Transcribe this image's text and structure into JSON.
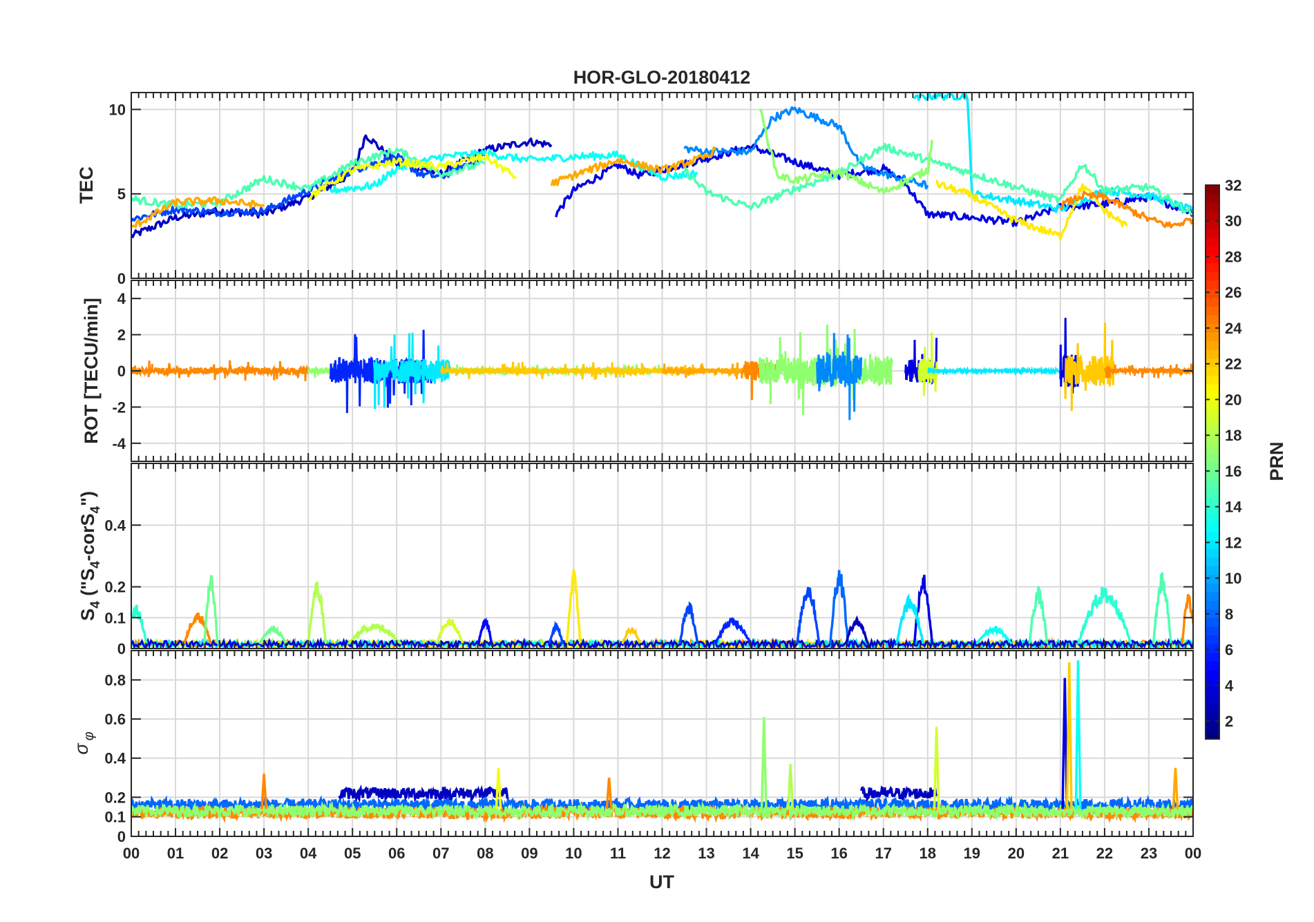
{
  "chart_data": {
    "type": "line",
    "title": "HOR-GLO-20180412",
    "xlabel": "UT",
    "x_tick_labels": [
      "00",
      "01",
      "02",
      "03",
      "04",
      "05",
      "06",
      "07",
      "08",
      "09",
      "10",
      "11",
      "12",
      "13",
      "14",
      "15",
      "16",
      "17",
      "18",
      "19",
      "20",
      "21",
      "22",
      "23",
      "00"
    ],
    "xlim": [
      0,
      24
    ],
    "grid": true,
    "colorbar": {
      "label": "PRN",
      "range": [
        1,
        32
      ],
      "tick_labels": [
        "2",
        "4",
        "6",
        "8",
        "10",
        "12",
        "14",
        "16",
        "18",
        "20",
        "22",
        "24",
        "26",
        "28",
        "30",
        "32"
      ],
      "colormap": "jet"
    },
    "panels": [
      {
        "id": "tec",
        "ylabel": "TEC",
        "ylim": [
          0,
          11
        ],
        "yticks": [
          0,
          5,
          10
        ],
        "y_tick_labels": [
          "0",
          "5",
          "10"
        ],
        "series": [
          {
            "prn": 3,
            "points": [
              [
                0,
                2.5
              ],
              [
                1,
                3.6
              ],
              [
                2,
                4.0
              ],
              [
                3,
                3.8
              ],
              [
                4,
                4.8
              ],
              [
                5,
                6.2
              ],
              [
                5.3,
                8.5
              ],
              [
                6,
                6.8
              ],
              [
                7,
                6.2
              ],
              [
                8,
                7.6
              ],
              [
                9,
                8.1
              ],
              [
                9.5,
                7.9
              ]
            ]
          },
          {
            "prn": 4,
            "points": [
              [
                9.6,
                3.8
              ],
              [
                10,
                5.2
              ],
              [
                11,
                6.7
              ],
              [
                11.5,
                6.1
              ],
              [
                13,
                7.1
              ],
              [
                14,
                7.8
              ],
              [
                15,
                6.9
              ],
              [
                16,
                6.1
              ],
              [
                17,
                6.5
              ],
              [
                17.5,
                5.6
              ],
              [
                18,
                3.8
              ],
              [
                19,
                3.6
              ],
              [
                20,
                3.3
              ],
              [
                21,
                4.2
              ],
              [
                22,
                4.4
              ],
              [
                23,
                4.8
              ],
              [
                24,
                3.9
              ]
            ]
          },
          {
            "prn": 7,
            "points": [
              [
                0,
                3.5
              ],
              [
                1,
                4.1
              ],
              [
                2,
                3.9
              ],
              [
                3,
                4.0
              ],
              [
                4,
                5.2
              ],
              [
                5,
                6.4
              ],
              [
                6,
                7.2
              ],
              [
                6.5,
                6.2
              ],
              [
                7,
                6.0
              ],
              [
                8,
                7.3
              ]
            ]
          },
          {
            "prn": 9,
            "points": [
              [
                12.5,
                7.7
              ],
              [
                13,
                7.5
              ],
              [
                14,
                7.5
              ],
              [
                14.5,
                9.5
              ],
              [
                15,
                10.0
              ],
              [
                16,
                9.0
              ],
              [
                16.5,
                6.6
              ],
              [
                17,
                6.2
              ],
              [
                18,
                5.5
              ]
            ]
          },
          {
            "prn": 12,
            "points": [
              [
                17.7,
                10.6
              ],
              [
                18,
                10.8
              ],
              [
                18.9,
                10.8
              ],
              [
                19,
                5.0
              ],
              [
                20,
                4.6
              ],
              [
                21,
                4.1
              ],
              [
                22,
                5.2
              ],
              [
                23,
                4.9
              ],
              [
                24,
                4.0
              ]
            ]
          },
          {
            "prn": 13,
            "points": [
              [
                4.5,
                5.2
              ],
              [
                5.5,
                5.5
              ],
              [
                6,
                6.5
              ],
              [
                7,
                7.2
              ],
              [
                8,
                7.4
              ],
              [
                9,
                7.0
              ],
              [
                10,
                7.2
              ],
              [
                11,
                7.3
              ],
              [
                12,
                6.0
              ],
              [
                12.8,
                6.2
              ]
            ]
          },
          {
            "prn": 15,
            "points": [
              [
                0,
                4.7
              ],
              [
                1,
                4.3
              ],
              [
                2,
                4.5
              ],
              [
                3,
                5.9
              ],
              [
                4,
                5.3
              ],
              [
                5,
                6.8
              ],
              [
                6,
                7.6
              ],
              [
                7,
                6.2
              ],
              [
                8,
                6.8
              ]
            ]
          },
          {
            "prn": 15,
            "points": [
              [
                12.5,
                6.4
              ],
              [
                13,
                5.1
              ],
              [
                14,
                4.2
              ],
              [
                15,
                5.3
              ],
              [
                16,
                6.2
              ],
              [
                17,
                7.8
              ],
              [
                21,
                4.6
              ],
              [
                21.5,
                6.8
              ],
              [
                22,
                5.2
              ],
              [
                23,
                5.4
              ],
              [
                24,
                3.8
              ]
            ]
          },
          {
            "prn": 17,
            "points": [
              [
                14.2,
                10.1
              ],
              [
                14.6,
                6.1
              ],
              [
                15,
                5.8
              ],
              [
                16,
                6.3
              ],
              [
                17,
                5.1
              ],
              [
                18,
                6.4
              ],
              [
                18.1,
                8.2
              ]
            ]
          },
          {
            "prn": 20,
            "points": [
              [
                4,
                4.8
              ],
              [
                5,
                6.4
              ],
              [
                6,
                6.9
              ],
              [
                7,
                6.6
              ],
              [
                8,
                7.2
              ],
              [
                8.7,
                6.0
              ]
            ]
          },
          {
            "prn": 21,
            "points": [
              [
                18.2,
                5.6
              ],
              [
                19,
                4.9
              ],
              [
                20,
                3.4
              ],
              [
                21,
                2.5
              ],
              [
                21.5,
                5.5
              ],
              [
                22,
                4.0
              ],
              [
                22.5,
                3.1
              ]
            ]
          },
          {
            "prn": 23,
            "points": [
              [
                0,
                3.0
              ],
              [
                1,
                4.5
              ],
              [
                2,
                4.6
              ],
              [
                3,
                4.3
              ]
            ]
          },
          {
            "prn": 23,
            "points": [
              [
                9.5,
                5.6
              ],
              [
                10,
                6.1
              ],
              [
                11,
                7.0
              ],
              [
                12,
                6.4
              ],
              [
                13,
                7.2
              ],
              [
                13.2,
                7.6
              ]
            ]
          },
          {
            "prn": 24,
            "points": [
              [
                21,
                4.3
              ],
              [
                21.5,
                4.9
              ],
              [
                22,
                4.8
              ],
              [
                23,
                3.5
              ],
              [
                23.5,
                3.1
              ],
              [
                24,
                3.5
              ]
            ]
          }
        ]
      },
      {
        "id": "rot",
        "ylabel": "ROT [TECU/min]",
        "ylim": [
          -5,
          5
        ],
        "yticks": [
          -4,
          -2,
          0,
          2,
          4
        ],
        "y_tick_labels": [
          "-4",
          "-2",
          "0",
          "2",
          "4"
        ],
        "bursts": [
          {
            "prn": 24,
            "start": 0,
            "end": 4,
            "amp": 0.6
          },
          {
            "prn": 17,
            "start": 4,
            "end": 12,
            "amp": 0.4
          },
          {
            "prn": 6,
            "start": 4.5,
            "end": 6.8,
            "amp": 2.4
          },
          {
            "prn": 12,
            "start": 5.5,
            "end": 7.2,
            "amp": 2.2
          },
          {
            "prn": 22,
            "start": 7,
            "end": 13,
            "amp": 0.5
          },
          {
            "prn": 23,
            "start": 12,
            "end": 14.5,
            "amp": 0.5
          },
          {
            "prn": 24,
            "start": 13.8,
            "end": 14.6,
            "amp": 1.8
          },
          {
            "prn": 17,
            "start": 14.2,
            "end": 17.2,
            "amp": 2.6
          },
          {
            "prn": 9,
            "start": 15.5,
            "end": 16.5,
            "amp": 3.0
          },
          {
            "prn": 4,
            "start": 17.5,
            "end": 18.2,
            "amp": 2.2
          },
          {
            "prn": 19,
            "start": 17.8,
            "end": 18.2,
            "amp": 2.4
          },
          {
            "prn": 12,
            "start": 18,
            "end": 21,
            "amp": 0.2
          },
          {
            "prn": 4,
            "start": 21,
            "end": 21.4,
            "amp": 3.0
          },
          {
            "prn": 22,
            "start": 21.1,
            "end": 22.2,
            "amp": 2.8
          },
          {
            "prn": 24,
            "start": 22,
            "end": 24,
            "amp": 0.4
          }
        ]
      },
      {
        "id": "s4",
        "ylabel": "S4 (\"S4-corS4\")",
        "ylim": [
          0,
          0.6
        ],
        "yticks": [
          0,
          0.1,
          0.2,
          0.4
        ],
        "y_tick_labels": [
          "0",
          "0.1",
          "0.2",
          "0.4"
        ],
        "peaks": [
          {
            "prn": 14,
            "x": 0.1,
            "w": 0.5,
            "peak": 0.14
          },
          {
            "prn": 24,
            "x": 1.5,
            "w": 0.6,
            "peak": 0.12
          },
          {
            "prn": 16,
            "x": 1.8,
            "w": 0.3,
            "peak": 0.24
          },
          {
            "prn": 16,
            "x": 3.2,
            "w": 0.6,
            "peak": 0.07
          },
          {
            "prn": 18,
            "x": 4.2,
            "w": 0.4,
            "peak": 0.22
          },
          {
            "prn": 18,
            "x": 5.5,
            "w": 1.2,
            "peak": 0.08
          },
          {
            "prn": 19,
            "x": 7.2,
            "w": 0.6,
            "peak": 0.1
          },
          {
            "prn": 5,
            "x": 8.0,
            "w": 0.3,
            "peak": 0.1
          },
          {
            "prn": 21,
            "x": 10.0,
            "w": 0.3,
            "peak": 0.26
          },
          {
            "prn": 7,
            "x": 9.6,
            "w": 0.3,
            "peak": 0.08
          },
          {
            "prn": 22,
            "x": 11.3,
            "w": 0.4,
            "peak": 0.07
          },
          {
            "prn": 7,
            "x": 12.6,
            "w": 0.4,
            "peak": 0.15
          },
          {
            "prn": 6,
            "x": 13.6,
            "w": 0.8,
            "peak": 0.1
          },
          {
            "prn": 7,
            "x": 15.3,
            "w": 0.5,
            "peak": 0.22
          },
          {
            "prn": 8,
            "x": 16.0,
            "w": 0.4,
            "peak": 0.27
          },
          {
            "prn": 3,
            "x": 16.4,
            "w": 0.5,
            "peak": 0.1
          },
          {
            "prn": 4,
            "x": 17.9,
            "w": 0.4,
            "peak": 0.25
          },
          {
            "prn": 12,
            "x": 17.6,
            "w": 0.6,
            "peak": 0.17
          },
          {
            "prn": 13,
            "x": 19.5,
            "w": 0.8,
            "peak": 0.07
          },
          {
            "prn": 15,
            "x": 20.5,
            "w": 0.4,
            "peak": 0.2
          },
          {
            "prn": 14,
            "x": 22.0,
            "w": 1.2,
            "peak": 0.2
          },
          {
            "prn": 15,
            "x": 23.3,
            "w": 0.4,
            "peak": 0.25
          },
          {
            "prn": 24,
            "x": 23.9,
            "w": 0.3,
            "peak": 0.18
          }
        ]
      },
      {
        "id": "sigma_phi",
        "ylabel": "σ φ",
        "ylim": [
          0,
          0.95
        ],
        "yticks": [
          0,
          0.1,
          0.2,
          0.4,
          0.6,
          0.8
        ],
        "y_tick_labels": [
          "0",
          "0.1",
          "0.2",
          "0.4",
          "0.6",
          "0.8"
        ],
        "baselines": [
          {
            "prn": 8,
            "start": 0,
            "end": 24,
            "level": 0.16
          },
          {
            "prn": 24,
            "start": 0,
            "end": 24,
            "level": 0.12
          },
          {
            "prn": 17,
            "start": 0,
            "end": 24,
            "level": 0.13
          },
          {
            "prn": 3,
            "start": 4.7,
            "end": 8.5,
            "level": 0.22
          },
          {
            "prn": 3,
            "start": 16.5,
            "end": 18.2,
            "level": 0.22
          }
        ],
        "spikes": [
          {
            "prn": 24,
            "x": 3.0,
            "peak": 0.32
          },
          {
            "prn": 20,
            "x": 8.3,
            "peak": 0.35
          },
          {
            "prn": 24,
            "x": 10.8,
            "peak": 0.3
          },
          {
            "prn": 17,
            "x": 14.3,
            "peak": 0.61
          },
          {
            "prn": 18,
            "x": 14.9,
            "peak": 0.37
          },
          {
            "prn": 19,
            "x": 18.2,
            "peak": 0.56
          },
          {
            "prn": 4,
            "x": 21.1,
            "peak": 0.81
          },
          {
            "prn": 22,
            "x": 21.2,
            "peak": 0.89
          },
          {
            "prn": 13,
            "x": 21.4,
            "peak": 0.9
          },
          {
            "prn": 23,
            "x": 23.6,
            "peak": 0.35
          }
        ]
      }
    ]
  }
}
